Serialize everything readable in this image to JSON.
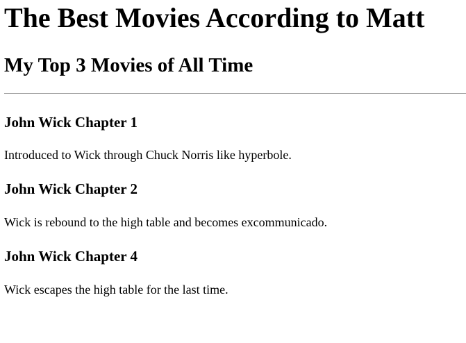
{
  "page": {
    "title": "The Best Movies According to Matt",
    "subtitle": "My Top 3 Movies of All Time"
  },
  "movies": [
    {
      "title": "John Wick Chapter 1",
      "description": "Introduced to Wick through Chuck Norris like hyperbole."
    },
    {
      "title": "John Wick Chapter 2",
      "description": "Wick is rebound to the high table and becomes excommunicado."
    },
    {
      "title": "John Wick Chapter 4",
      "description": "Wick escapes the high table for the last time."
    }
  ],
  "colors": {
    "text": "#000000",
    "background": "#ffffff",
    "divider": "#9a9a9a"
  }
}
